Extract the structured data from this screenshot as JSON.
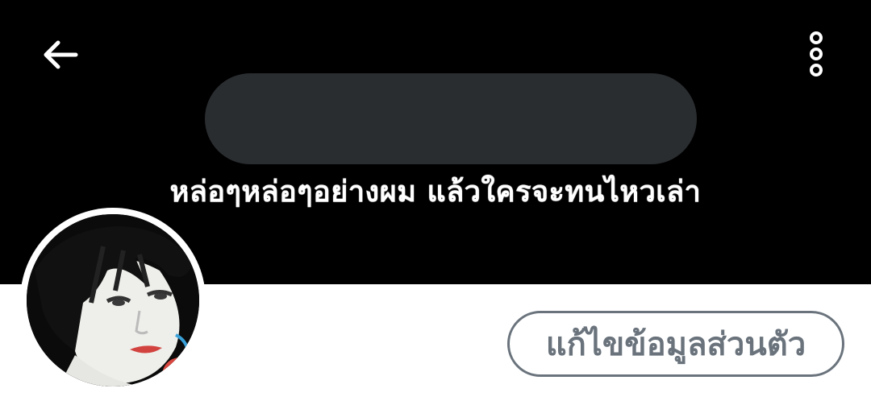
{
  "header": {
    "back_icon": "arrow-left-icon",
    "more_icon": "more-vertical-icon"
  },
  "banner": {
    "caption": "หล่อๆหล่อๆอย่างผม แล้วใครจะทนไหวเล่า",
    "background_color": "#000000",
    "redaction_color": "#2a2d30"
  },
  "profile": {
    "avatar": "profile-photo",
    "edit_profile_label": "แก้ไขข้อมูลส่วนตัว",
    "button_color": "#6a737c"
  }
}
